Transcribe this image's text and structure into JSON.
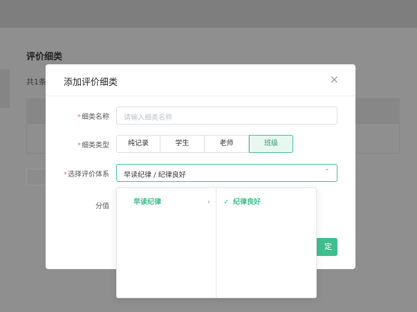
{
  "background": {
    "page_title": "评价细类",
    "count_prefix": "共1条"
  },
  "modal": {
    "title": "添加评价细类",
    "close_icon": "×",
    "fields": {
      "name": {
        "label": "细类名称",
        "placeholder": "请输入细类名称"
      },
      "type": {
        "label": "细类类型",
        "options": [
          "纯记录",
          "学生",
          "老师",
          "班级"
        ],
        "selected": "班级"
      },
      "system": {
        "label": "选择评价体系",
        "value": "早读纪律 / 纪律良好",
        "chevron": "⌃"
      },
      "score": {
        "label": "分值"
      }
    },
    "confirm_label": "定"
  },
  "cascader": {
    "level1": {
      "label": "早读纪律",
      "arrow": "›"
    },
    "level2": {
      "label": "纪律良好",
      "check": "✓"
    }
  },
  "colors": {
    "accent": "#3fbf8e",
    "required": "#f56c6c"
  }
}
